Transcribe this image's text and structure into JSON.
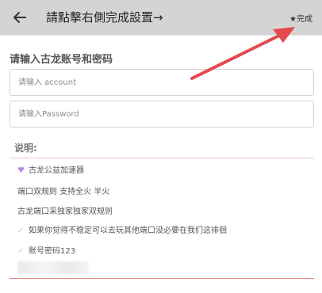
{
  "appbar": {
    "title": "請點擊右側完成設置→",
    "done_label": "★完成"
  },
  "form": {
    "section_label": "请输入古龙账号和密码",
    "account_placeholder": "请输入 account",
    "password_placeholder": "请输入Password"
  },
  "notes": {
    "title": "说明:",
    "items": [
      {
        "text": "古龙公益加速器",
        "icon": "heart-icon"
      },
      {
        "text": "端口双规则 支持全火 半火",
        "icon": ""
      },
      {
        "text": "古龙端口采独家独家双规则",
        "icon": ""
      },
      {
        "text": "如果你觉得不稳定可以去玩其他端口没必要在我们这徘徊",
        "icon": "check-icon"
      },
      {
        "text": "账号密码123",
        "icon": "check-icon"
      }
    ]
  },
  "colors": {
    "appbar": "#d4d4d4",
    "annotation_arrow": "#e5484d",
    "divider": "#f2c8c8"
  }
}
